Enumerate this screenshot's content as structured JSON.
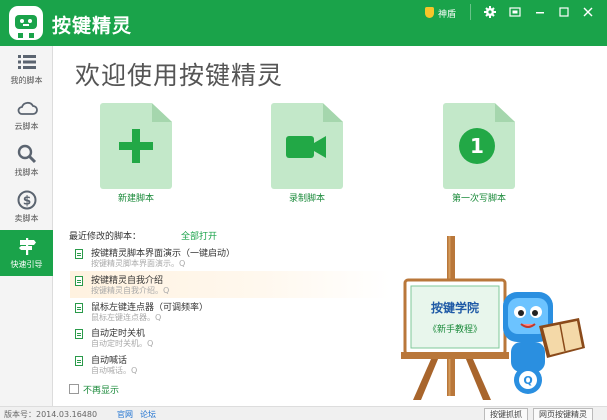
{
  "app": {
    "title": "按键精灵"
  },
  "titlebar": {
    "shield_label": "神盾"
  },
  "sidebar": {
    "items": [
      {
        "label": "我的脚本",
        "icon": "list-icon"
      },
      {
        "label": "云脚本",
        "icon": "cloud-icon"
      },
      {
        "label": "找脚本",
        "icon": "search-icon"
      },
      {
        "label": "卖脚本",
        "icon": "dollar-icon"
      },
      {
        "label": "快速引导",
        "icon": "signpost-icon",
        "active": true
      }
    ]
  },
  "main": {
    "welcome": "欢迎使用按键精灵",
    "cards": [
      {
        "label": "新建脚本",
        "icon": "plus-icon"
      },
      {
        "label": "录制脚本",
        "icon": "video-camera-icon"
      },
      {
        "label": "第一次写脚本",
        "icon": "number-one-icon",
        "badge": "1"
      }
    ],
    "recent_title": "最近修改的脚本：",
    "open_all": "全部打开",
    "scripts": [
      {
        "name": "按键精灵脚本界面演示（一键启动）",
        "desc": "按键精灵脚本界面演示。Q"
      },
      {
        "name": "按键精灵自我介绍",
        "desc": "按键精灵自我介绍。Q"
      },
      {
        "name": "鼠标左键连点器（可调频率）",
        "desc": "鼠标左键连点器。Q"
      },
      {
        "name": "自动定时关机",
        "desc": "自动定时关机。Q"
      },
      {
        "name": "自动喊话",
        "desc": "自动喊话。Q"
      }
    ],
    "no_show": "不再显示",
    "easel": {
      "line1": "按键学院",
      "line2": "《新手教程》"
    }
  },
  "statusbar": {
    "version": "版本号：2014.03.16480",
    "link_official": "官网",
    "link_forum": "论坛",
    "btn_grab": "按键抓抓",
    "btn_web": "网页按键精灵"
  },
  "colors": {
    "brand": "#1aa34a",
    "card_bg": "#c3e8c9",
    "highlight": "#fff2e0"
  }
}
